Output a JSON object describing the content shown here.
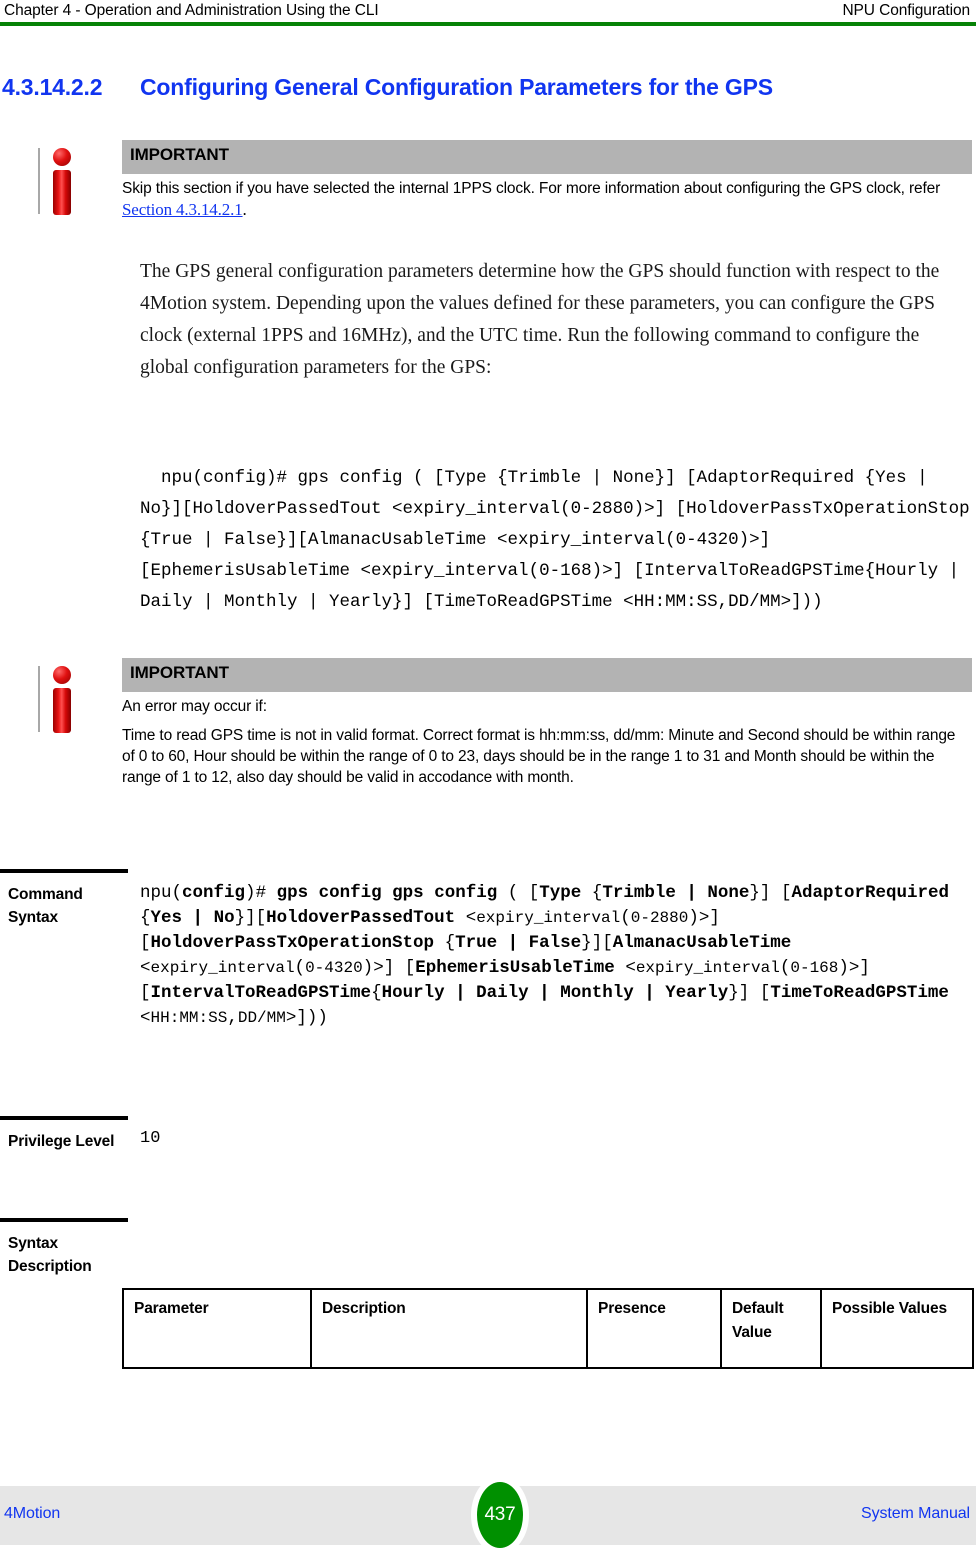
{
  "header": {
    "left": "Chapter 4 - Operation and Administration Using the CLI",
    "right": "NPU Configuration",
    "rule_color": "#068206"
  },
  "heading": {
    "number": "4.3.14.2.2",
    "title": "Configuring General Configuration Parameters for the GPS",
    "color": "#1135f0"
  },
  "note1": {
    "icon": "important-info-icon",
    "band_title": "IMPORTANT",
    "band_color": "#b3b3b3",
    "text_before_link": "Skip this section if you have selected the internal 1PPS clock. For more information about configuring the GPS clock, refer ",
    "link_text": "Section 4.3.14.2.1",
    "text_after_link": "."
  },
  "body_paragraph": "The GPS general configuration parameters determine how the GPS should function with respect to the 4Motion system. Depending upon the values defined for these parameters, you can configure the GPS clock (external 1PPS and 16MHz), and the UTC time. Run the following command to configure the global configuration parameters for the GPS:",
  "command_inline": "npu(config)# gps config ( [Type {Trimble | None}] [AdaptorRequired {Yes | No}][HoldoverPassedTout <expiry_interval(0-2880)>] [HoldoverPassTxOperationStop {True | False}][AlmanacUsableTime <expiry_interval(0-4320)>] [EphemerisUsableTime <expiry_interval(0-168)>] [IntervalToReadGPSTime{Hourly | Daily | Monthly | Yearly}] [TimeToReadGPSTime <HH:MM:SS,DD/MM>]))",
  "note2": {
    "icon": "important-info-icon",
    "band_title": "IMPORTANT",
    "band_color": "#b3b3b3",
    "line1": "An error may occur if:",
    "line2": "Time to read GPS time is not in valid format. Correct format is  hh:mm:ss, dd/mm: Minute and Second should be within range of 0 to 60, Hour should be within the range of 0 to 23, days should be in the range 1 to 31 and  Month should be within the range of 1 to 12, also day should be valid in accodance with month."
  },
  "rows": {
    "command_syntax": {
      "label": "Command Syntax",
      "value": "npu(config)# gps config gps config ( [Type {Trimble | None}] [AdaptorRequired {Yes | No}][HoldoverPassedTout <expiry_interval(0-2880)>] [HoldoverPassTxOperationStop {True | False}][AlmanacUsableTime <expiry_interval(0-4320)>] [EphemerisUsableTime <expiry_interval(0-168)>] [IntervalToReadGPSTime{Hourly | Daily | Monthly | Yearly}] [TimeToReadGPSTime <HH:MM:SS,DD/MM>]))"
    },
    "privilege_level": {
      "label": "Privilege Level",
      "value": "10"
    },
    "syntax_description": {
      "label": "Syntax Description"
    }
  },
  "param_table": {
    "columns": [
      "Parameter",
      "Description",
      "Presence",
      "Default Value",
      "Possible Values"
    ],
    "rows": []
  },
  "footer": {
    "left": "4Motion",
    "page_number": "437",
    "right": "System Manual",
    "badge_color": "#009000",
    "band_color": "#e6e6e6",
    "link_color": "#1135f0"
  }
}
